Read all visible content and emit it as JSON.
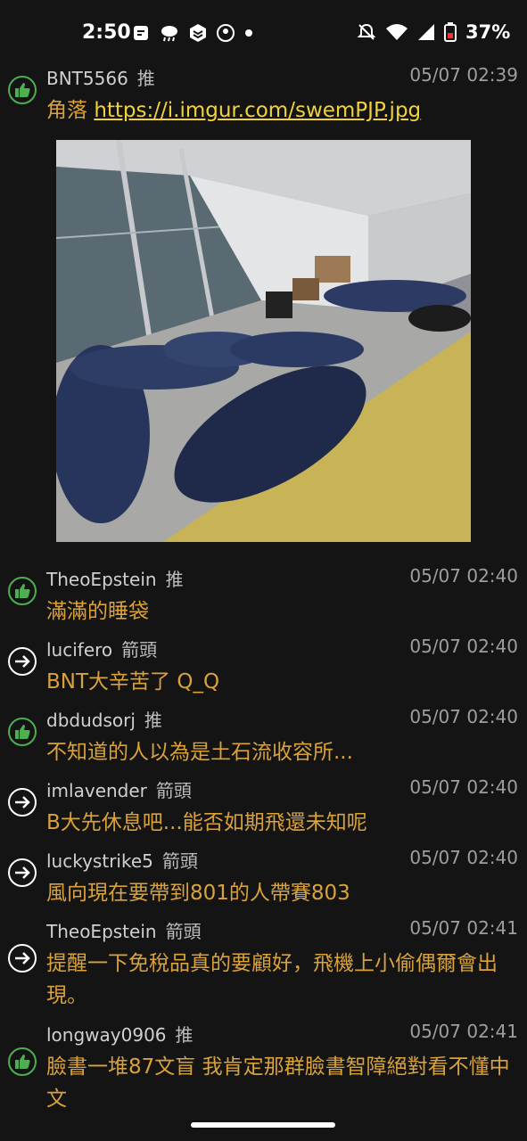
{
  "status_bar": {
    "time": "2:50",
    "icons_left": [
      "notification-icon",
      "weather-icon",
      "app-icon",
      "app-icon",
      "dot"
    ],
    "icons_right": [
      "mute-icon",
      "wifi-icon",
      "signal-icon",
      "battery-icon"
    ],
    "battery": "37%"
  },
  "comments": [
    {
      "user": "BNT5566",
      "tag": "推",
      "type": "push",
      "time": "05/07 02:39",
      "text_prefix": "角落 ",
      "link": "https://i.imgur.com/swemPJP.jpg"
    },
    {
      "user": "TheoEpstein",
      "tag": "推",
      "type": "push",
      "time": "05/07 02:40",
      "text": "滿滿的睡袋"
    },
    {
      "user": "lucifero",
      "tag": "箭頭",
      "type": "arrow",
      "time": "05/07 02:40",
      "text": "BNT大辛苦了 Q_Q"
    },
    {
      "user": "dbdudsorj",
      "tag": "推",
      "type": "push",
      "time": "05/07 02:40",
      "text": "不知道的人以為是土石流收容所..."
    },
    {
      "user": "imlavender",
      "tag": "箭頭",
      "type": "arrow",
      "time": "05/07 02:40",
      "text": "B大先休息吧...能否如期飛還未知呢"
    },
    {
      "user": "luckystrike5",
      "tag": "箭頭",
      "type": "arrow",
      "time": "05/07 02:40",
      "text": "風向現在要帶到801的人帶賽803"
    },
    {
      "user": "TheoEpstein",
      "tag": "箭頭",
      "type": "arrow",
      "time": "05/07 02:41",
      "text": "提醒一下免稅品真的要顧好，飛機上小偷偶爾會出現。"
    },
    {
      "user": "longway0906",
      "tag": "推",
      "type": "push",
      "time": "05/07 02:41",
      "text": "臉書一堆87文盲 我肯定那群臉書智障絕對看不懂中文"
    }
  ],
  "colors": {
    "background": "#141414",
    "push_icon": "#4caf50",
    "comment_text": "#d9a23a",
    "link_text": "#f2d23a"
  }
}
